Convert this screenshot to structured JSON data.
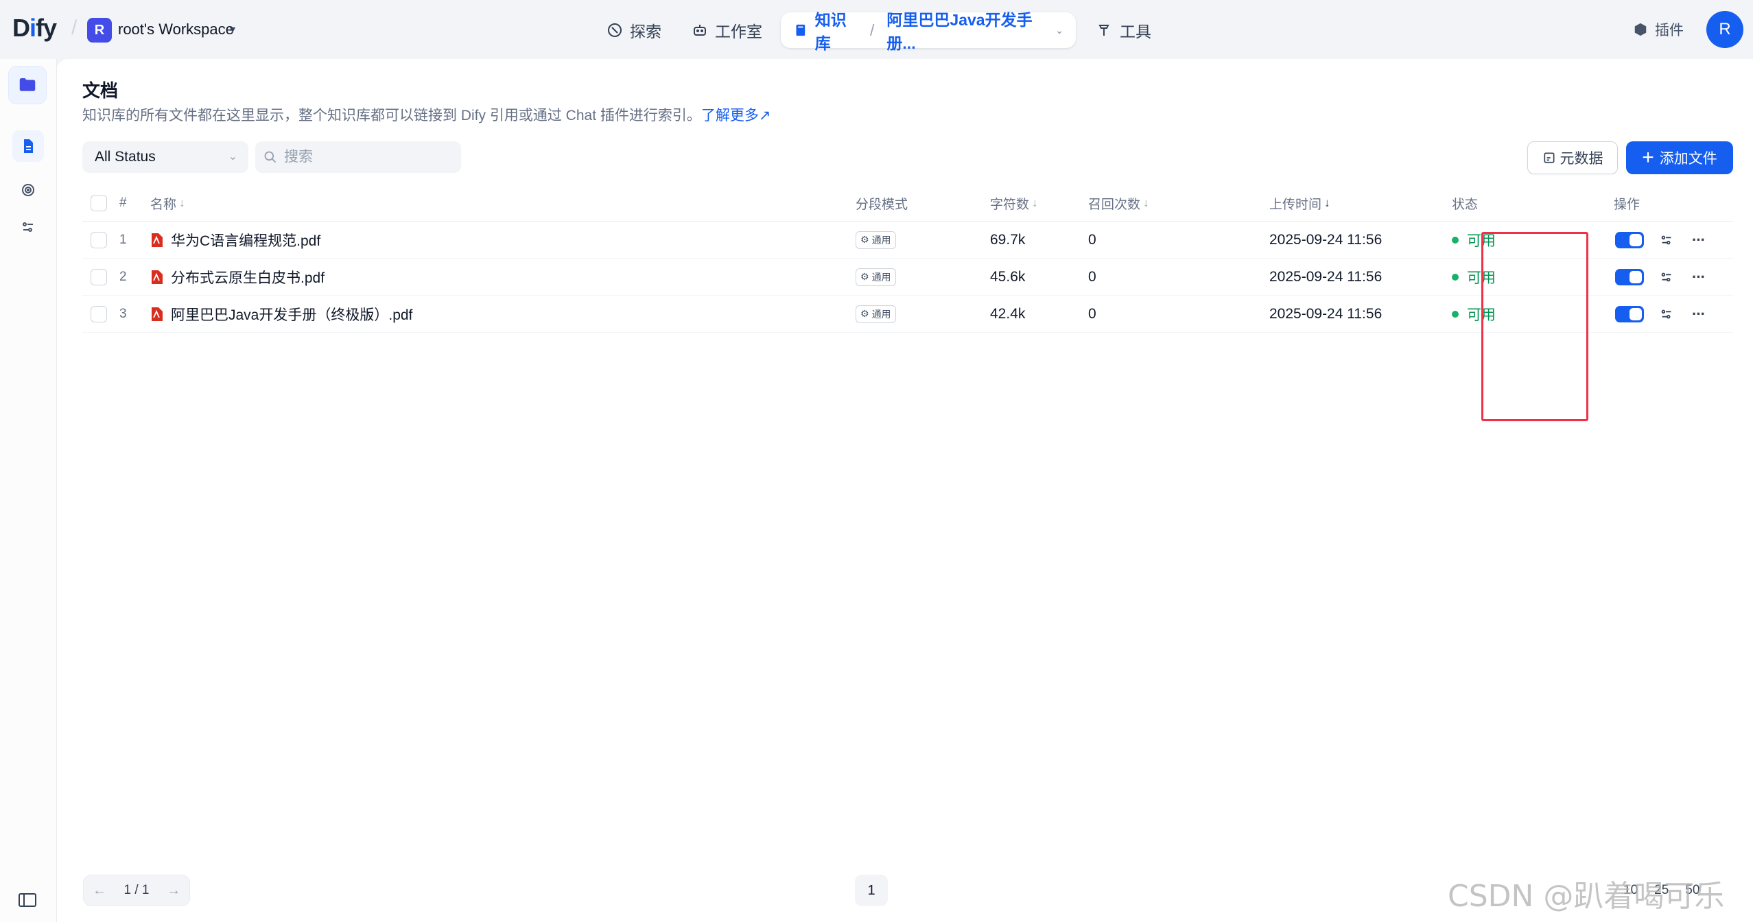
{
  "app": {
    "logo_prefix": "D",
    "logo_i": "i",
    "logo_suffix": "fy"
  },
  "workspace": {
    "avatar": "R",
    "name": "root's Workspace"
  },
  "nav": {
    "explore": "探索",
    "studio": "工作室",
    "knowledge": "知识库",
    "current_dataset": "阿里巴巴Java开发手册...",
    "tools": "工具"
  },
  "header": {
    "plugins": "插件",
    "user_avatar": "R"
  },
  "page": {
    "title": "文档",
    "description": "知识库的所有文件都在这里显示，整个知识库都可以链接到 Dify 引用或通过 Chat 插件进行索引。",
    "learn_more": "了解更多"
  },
  "filters": {
    "status_value": "All Status",
    "search_placeholder": "搜索"
  },
  "actions": {
    "metadata": "元数据",
    "add_file": "添加文件"
  },
  "table": {
    "columns": {
      "index": "#",
      "name": "名称",
      "mode": "分段模式",
      "chars": "字符数",
      "hits": "召回次数",
      "upload_time": "上传时间",
      "status": "状态",
      "actions": "操作"
    },
    "rows": [
      {
        "index": "1",
        "name": "华为C语言编程规范.pdf",
        "mode": "通用",
        "chars": "69.7k",
        "hits": "0",
        "upload_time": "2025-09-24 11:56",
        "status": "可用",
        "enabled": true
      },
      {
        "index": "2",
        "name": "分布式云原生白皮书.pdf",
        "mode": "通用",
        "chars": "45.6k",
        "hits": "0",
        "upload_time": "2025-09-24 11:56",
        "status": "可用",
        "enabled": true
      },
      {
        "index": "3",
        "name": "阿里巴巴Java开发手册（终极版）.pdf",
        "mode": "通用",
        "chars": "42.4k",
        "hits": "0",
        "upload_time": "2025-09-24 11:56",
        "status": "可用",
        "enabled": true
      }
    ]
  },
  "pagination": {
    "page_indicator": "1 / 1",
    "current_page": "1",
    "per_page": [
      "10",
      "25",
      "50"
    ]
  },
  "watermark": "CSDN @趴着喝可乐",
  "colors": {
    "accent": "#155eef",
    "status_ok": "#17b26a",
    "highlight": "#f03048"
  }
}
